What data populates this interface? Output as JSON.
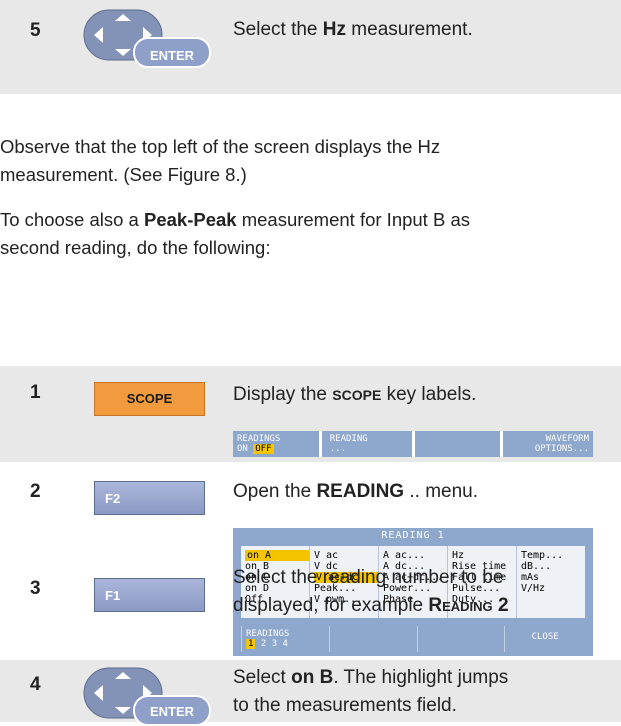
{
  "step5": {
    "num": "5",
    "enter_label": "ENTER",
    "text_pre": "Select the ",
    "text_bold": "Hz",
    "text_post": " measurement."
  },
  "para1": {
    "line1": "Observe that the top left of the screen displays the Hz",
    "line2": "measurement. (See Figure 8.)"
  },
  "para2": {
    "line1_pre": "To choose also a ",
    "line1_bold": "Peak-Peak",
    "line1_post": " measurement for Input B as",
    "line2": "second reading, do the following:"
  },
  "step1": {
    "num": "1",
    "key_label": "SCOPE",
    "text_pre": "Display the ",
    "text_sc": "SCOPE",
    "text_post": " key labels.",
    "fkeys": {
      "k1_line1": "READINGS",
      "k1_on": "ON",
      "k1_off": "OFF",
      "k2_line1": "READING",
      "k2_line2": "...",
      "k3": "",
      "k4_line1": "WAVEFORM",
      "k4_line2": "OPTIONS..."
    }
  },
  "step2": {
    "num": "2",
    "key_label": "F2",
    "text_pre": "Open the ",
    "text_bold": "READING",
    "text_post": " .. menu.",
    "menu": {
      "title": "READING 1",
      "col1": [
        "on A",
        "on B",
        "on C",
        "on D",
        "Off"
      ],
      "col2": [
        "V ac",
        "V dc",
        "V ac+dc",
        "Peak...",
        "V pwm..."
      ],
      "col3": [
        "A ac...",
        "A dc...",
        "A ac+dc...",
        "Power...",
        "Phase"
      ],
      "col4": [
        "Hz",
        "Rise time",
        "Fall time",
        "Pulse...",
        "Duty..."
      ],
      "col5": [
        "Temp...",
        "dB...",
        "mAs",
        "V/Hz",
        ""
      ],
      "bar_readings": "READINGS",
      "bar_nums": [
        "1",
        "2",
        "3",
        "4"
      ],
      "bar_close": "CLOSE"
    }
  },
  "step3": {
    "num": "3",
    "key_label": "F1",
    "line1": "Select the reading number to be",
    "line2_pre": "displayed, for example ",
    "line2_sc": "Reading 2"
  },
  "step4": {
    "num": "4",
    "enter_label": "ENTER",
    "line1_pre": "Select ",
    "line1_bold": "on B",
    "line1_post": ". The highlight jumps",
    "line2": "to the measurements field."
  },
  "colors": {
    "band": "#e8e8e8",
    "scope_key": "#f19a3e",
    "fkey": "#8ea7cc",
    "highlight": "#f5c400"
  }
}
